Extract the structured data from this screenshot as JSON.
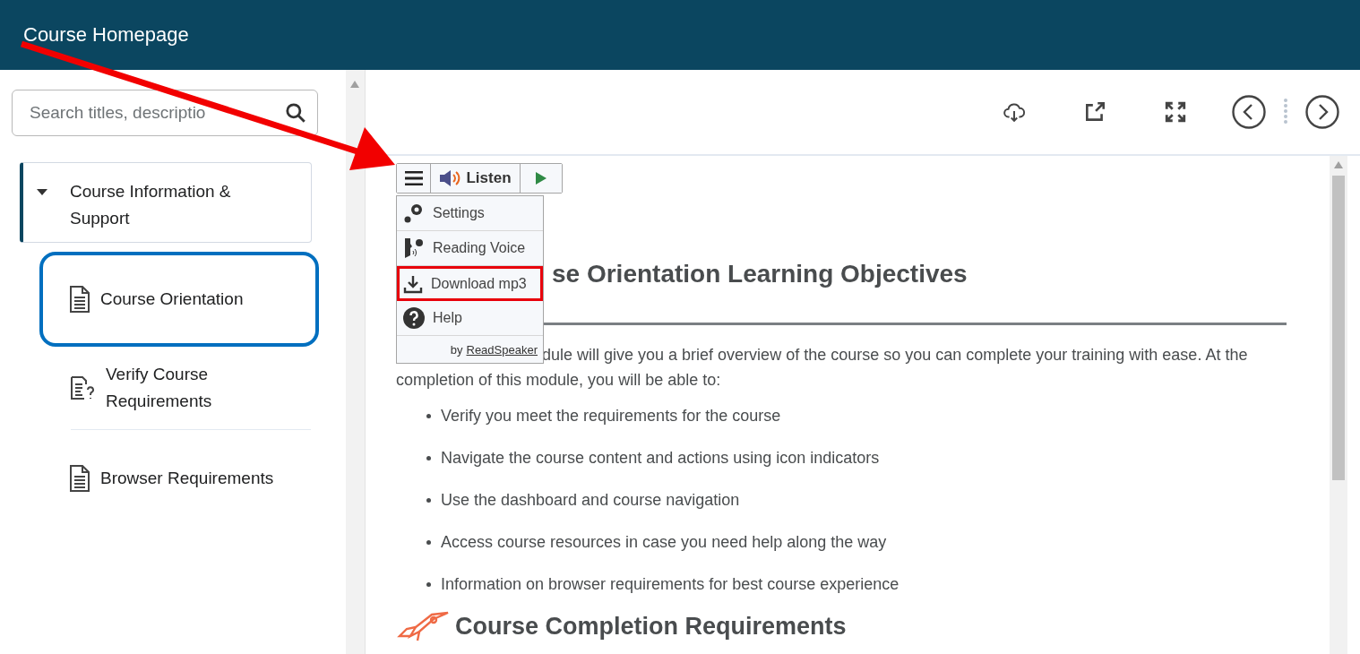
{
  "header": {
    "title": "Course Homepage"
  },
  "sidebar": {
    "search": {
      "placeholder": "Search titles, descriptio"
    },
    "module": {
      "title": "Course Information & Support",
      "expanded": true,
      "children": [
        {
          "title": "Course Orientation",
          "kind": "page",
          "selected": true
        },
        {
          "title": "Verify Course Requirements",
          "kind": "checklist",
          "selected": false
        },
        {
          "title": "Browser Requirements",
          "kind": "page",
          "selected": false
        }
      ]
    }
  },
  "reader": {
    "listen_label": "Listen",
    "menu": [
      {
        "label": "Settings",
        "kind": "settings",
        "highlighted": false
      },
      {
        "label": "Reading Voice",
        "kind": "voice",
        "highlighted": false
      },
      {
        "label": "Download mp3",
        "kind": "download",
        "highlighted": true
      },
      {
        "label": "Help",
        "kind": "help",
        "highlighted": false
      }
    ],
    "credit_prefix": "by",
    "credit_link": "ReadSpeaker"
  },
  "content": {
    "heading": "se Orientation Learning Objectives",
    "intro_lines": [
      "dule will give you a brief overview of the course so you can complete your training with ease. At the",
      "completion of this module, you will be able to:"
    ],
    "bullets": [
      "Verify you meet the requirements for the course",
      "Navigate the course content and actions using icon indicators",
      "Use the dashboard and course navigation",
      "Access course resources in case you need help along the way",
      "Information on browser requirements for best course experience"
    ],
    "section_heading": "Course Completion Requirements"
  }
}
